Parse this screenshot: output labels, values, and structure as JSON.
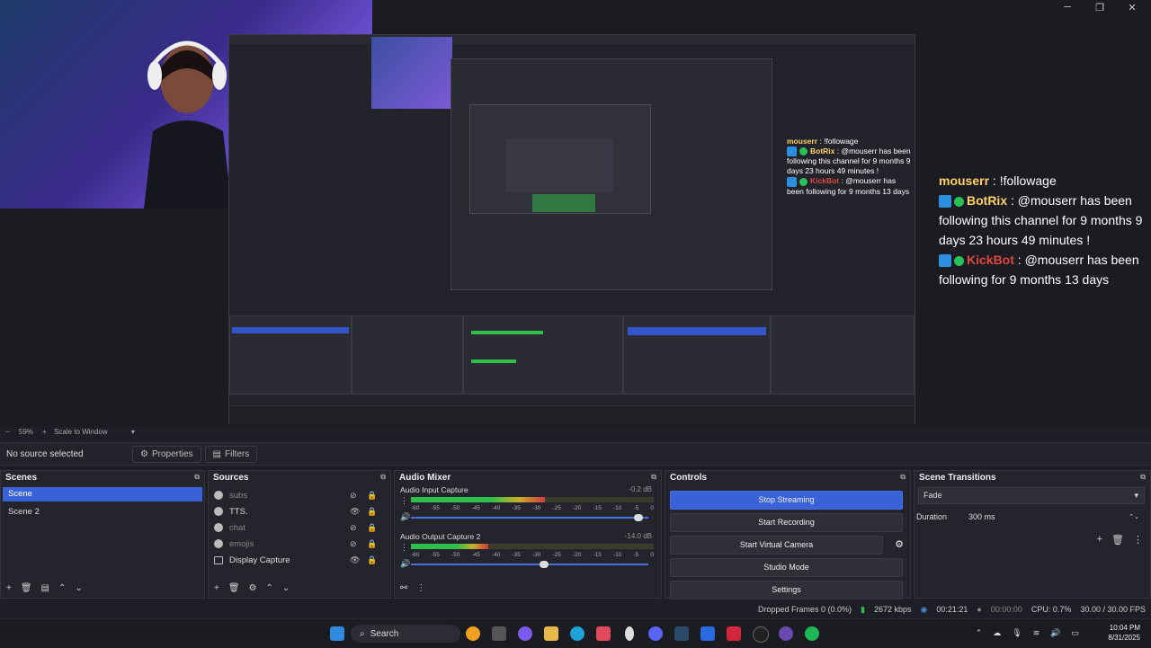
{
  "window_controls": {
    "minimize": "─",
    "maximize": "❐",
    "close": "✕"
  },
  "preview": {
    "chat_small": [
      {
        "user": "mouserr",
        "text": " : !followage"
      },
      {
        "user": "BotRix",
        "text": " : @mouserr has been following this channel for 9 months 9 days 23 hours 49 minutes !"
      },
      {
        "user": "KickBot",
        "text": " : @mouserr has been following for 9 months 13 days"
      }
    ],
    "chat_big": [
      {
        "user": "mouserr",
        "text": " : !followage"
      },
      {
        "user": "BotRix",
        "text": " : @mouserr has been following this channel for 9 months 9 days 23 hours 49 minutes !"
      },
      {
        "user": "KickBot",
        "text": " : @mouserr has been following for 9 months 13 days"
      }
    ]
  },
  "zoombar": {
    "zoom": "59%",
    "mode": "Scale to Window"
  },
  "source_bar": {
    "status": "No source selected",
    "properties": "Properties",
    "filters": "Filters"
  },
  "scenes": {
    "title": "Scenes",
    "items": [
      "Scene",
      "Scene 2"
    ]
  },
  "sources": {
    "title": "Sources",
    "items": [
      {
        "label": "subs",
        "visible": false
      },
      {
        "label": "TTS.",
        "visible": true
      },
      {
        "label": "chat",
        "visible": false
      },
      {
        "label": "emojis",
        "visible": false
      },
      {
        "label": "Display Capture",
        "visible": true
      }
    ]
  },
  "mixer": {
    "title": "Audio Mixer",
    "channels": [
      {
        "name": "Audio Input Capture",
        "db": "-0.2 dB",
        "level": 0.55,
        "volume": 0.96
      },
      {
        "name": "Audio Output Capture 2",
        "db": "-14.0 dB",
        "level": 0.32,
        "volume": 0.56
      }
    ],
    "ticks": [
      "-60",
      "-55",
      "-50",
      "-45",
      "-40",
      "-35",
      "-30",
      "-25",
      "-20",
      "-15",
      "-10",
      "-5",
      "0"
    ]
  },
  "controls": {
    "title": "Controls",
    "buttons": [
      "Stop Streaming",
      "Start Recording",
      "Start Virtual Camera",
      "Studio Mode",
      "Settings"
    ]
  },
  "transitions": {
    "title": "Scene Transitions",
    "selected": "Fade",
    "duration_label": "Duration",
    "duration_value": "300 ms"
  },
  "status": {
    "dropped": "Dropped Frames 0 (0.0%)",
    "kbps": "2672 kbps",
    "stream_time": "00:21:21",
    "rec_time": "00:00:00",
    "cpu": "CPU: 0.7%",
    "fps": "30.00 / 30.00 FPS"
  },
  "taskbar": {
    "search": "Search",
    "time": "10:04 PM",
    "date": "8/31/2025"
  }
}
